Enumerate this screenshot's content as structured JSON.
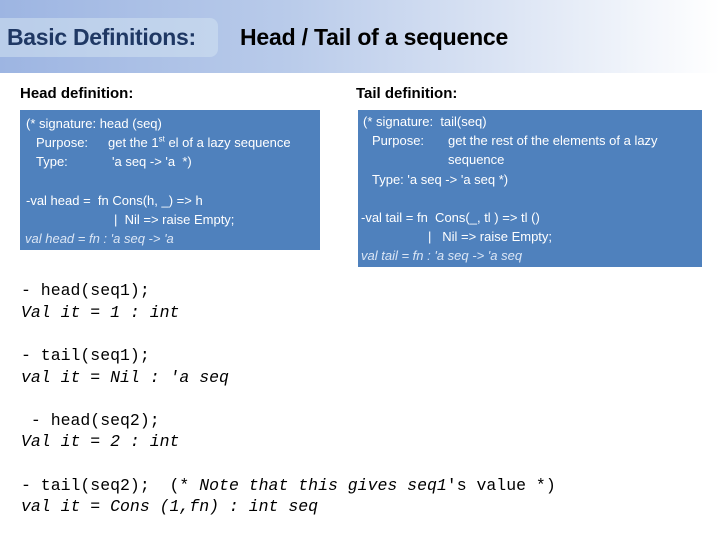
{
  "header": {
    "section": "Basic Definitions:",
    "title": "Head / Tail of a sequence"
  },
  "head": {
    "label": "Head definition:",
    "line1": "(* signature: head (seq)",
    "purpose_label": "Purpose:",
    "purpose_pre": "get the 1",
    "purpose_sup": "st",
    "purpose_post": " el of a lazy sequence",
    "type_label": "Type:",
    "type_value": "'a seq -> 'a  *)",
    "code1": "-val head =  fn Cons(h, _) => h",
    "code2": "|  Nil => raise Empty;",
    "result": "val head = fn : 'a seq -> 'a"
  },
  "tail": {
    "label": "Tail definition:",
    "line1": "(* signature:  tail(seq)",
    "purpose_label": "Purpose:",
    "purpose_value1": "get the rest of the elements of a lazy",
    "purpose_value2": "sequence",
    "type_line": "Type: 'a seq -> 'a seq *)",
    "code1": "-val tail = fn  Cons(_, tl ) => tl ()",
    "code2": "|   Nil => raise Empty;",
    "result": "val tail = fn : 'a seq -> 'a seq"
  },
  "repl": [
    {
      "input": "- head(seq1);",
      "output": "Val it = 1 : int"
    },
    {
      "input": "- tail(seq1);",
      "output": "val it = Nil : 'a seq"
    },
    {
      "input": " - head(seq2);",
      "output": "Val it = 2 : int"
    },
    {
      "input": "- tail(seq2);  ",
      "comment_open": "(* ",
      "comment_text": "Note that this gives seq1",
      "comment_rest": "'s value *)",
      "output": "val it = Cons (1,fn) : int seq"
    }
  ],
  "colors": {
    "box": "#4f81bd",
    "section_text": "#1f3864"
  }
}
